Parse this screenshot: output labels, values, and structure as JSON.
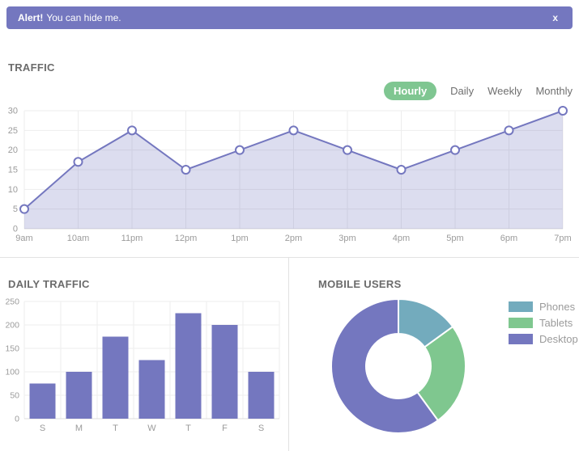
{
  "alert": {
    "prefix": "Alert!",
    "message": "You can hide me.",
    "close_label": "x",
    "bg_color": "#7477bf"
  },
  "traffic": {
    "title": "TRAFFIC",
    "tabs": [
      {
        "label": "Hourly",
        "active": true
      },
      {
        "label": "Daily",
        "active": false
      },
      {
        "label": "Weekly",
        "active": false
      },
      {
        "label": "Monthly",
        "active": false
      }
    ],
    "active_tab_color": "#7fc691"
  },
  "chart_data": [
    {
      "id": "traffic-hourly",
      "type": "area",
      "title": "TRAFFIC",
      "x": [
        "9am",
        "10am",
        "11pm",
        "12pm",
        "1pm",
        "2pm",
        "3pm",
        "4pm",
        "5pm",
        "6pm",
        "7pm"
      ],
      "values": [
        5,
        17,
        25,
        15,
        20,
        25,
        20,
        15,
        20,
        25,
        30
      ],
      "ylim": [
        0,
        30
      ],
      "yticks": [
        0,
        5,
        10,
        15,
        20,
        25,
        30
      ],
      "grid": true,
      "legend_position": "none",
      "line_color": "#7477bf",
      "fill_color": "rgba(116,119,191,0.25)",
      "point_style": "white-circle-purple-border"
    },
    {
      "id": "daily-traffic",
      "type": "bar",
      "title": "DAILY TRAFFIC",
      "categories": [
        "S",
        "M",
        "T",
        "W",
        "T",
        "F",
        "S"
      ],
      "values": [
        75,
        100,
        175,
        125,
        225,
        200,
        100
      ],
      "ylim": [
        0,
        250
      ],
      "yticks": [
        0,
        50,
        100,
        150,
        200,
        250
      ],
      "grid": true,
      "legend_position": "none",
      "bar_color": "#7477bf"
    },
    {
      "id": "mobile-users",
      "type": "pie",
      "title": "MOBILE USERS",
      "donut": true,
      "legend_position": "right",
      "slices": [
        {
          "label": "Phones",
          "percent": 15,
          "color": "#73abbd"
        },
        {
          "label": "Tablets",
          "percent": 25,
          "color": "#7fc78f"
        },
        {
          "label": "Desktop",
          "percent": 60,
          "color": "#7477bf"
        }
      ]
    }
  ],
  "colors": {
    "accent_purple": "#7477bf",
    "accent_green": "#7fc691",
    "accent_teal": "#73abbd",
    "axis_text": "#9b9b9b",
    "heading_text": "#6b6b6b",
    "grid_line": "#ededed",
    "divider": "#e2e2e2"
  }
}
